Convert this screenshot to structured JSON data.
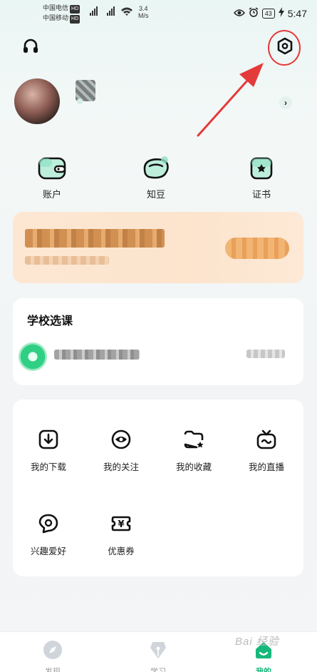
{
  "status_bar": {
    "carrier1": "中国电信",
    "carrier2": "中国移动",
    "hd": "HD",
    "signal": "⁴ᴳ",
    "speed_value": "3.4",
    "speed_unit": "M/s",
    "battery": "43",
    "time": "5:47"
  },
  "quick_actions": [
    {
      "label": "账户",
      "icon": "wallet-icon"
    },
    {
      "label": "知豆",
      "icon": "bean-icon"
    },
    {
      "label": "证书",
      "icon": "certificate-icon"
    }
  ],
  "school_section": {
    "title": "学校选课"
  },
  "feature_grid": [
    {
      "label": "我的下载",
      "icon": "download-icon"
    },
    {
      "label": "我的关注",
      "icon": "eye-icon"
    },
    {
      "label": "我的收藏",
      "icon": "favorite-folder-icon"
    },
    {
      "label": "我的直播",
      "icon": "live-tv-icon"
    },
    {
      "label": "兴趣爱好",
      "icon": "interest-icon"
    },
    {
      "label": "优惠券",
      "icon": "coupon-icon"
    }
  ],
  "bottom_nav": [
    {
      "label": "发现",
      "icon": "compass-icon",
      "active": false
    },
    {
      "label": "学习",
      "icon": "pen-icon",
      "active": false
    },
    {
      "label": "我的",
      "icon": "me-icon",
      "active": true
    }
  ],
  "watermark": "Bai 经验",
  "colors": {
    "accent": "#16b87b",
    "highlight_circle": "#e53a3a",
    "banner_bg": "#fde7d3",
    "icon_fill": "#bdeedc"
  }
}
